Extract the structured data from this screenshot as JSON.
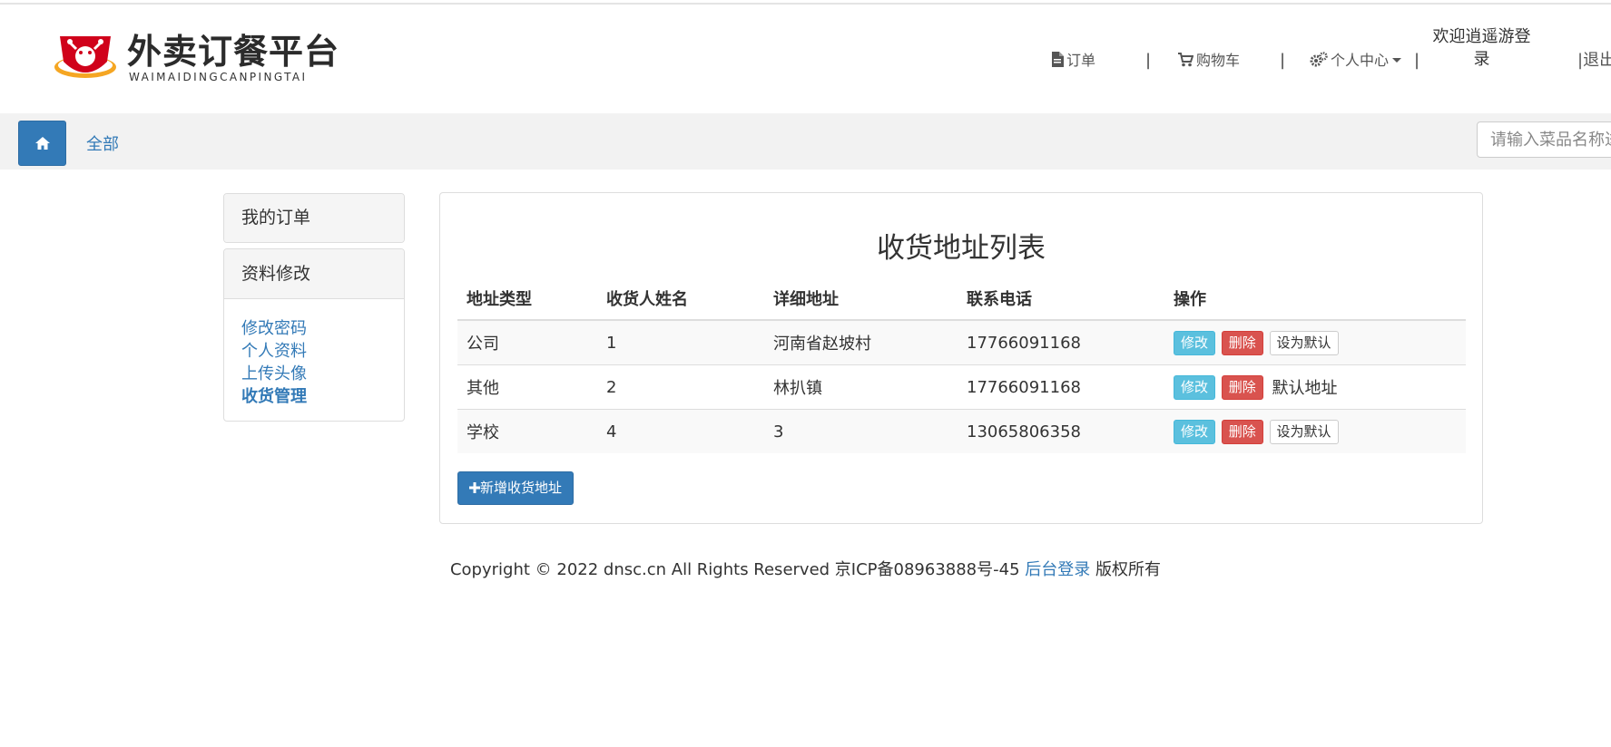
{
  "brand": {
    "name_cn": "外卖订餐平台",
    "name_en": "WAIMAIDINGCANPINGTAI",
    "logo_icon": "crab-logo-icon"
  },
  "nav": {
    "orders": {
      "label": "订单",
      "icon": "file-icon"
    },
    "cart": {
      "label": "购物车",
      "icon": "cart-icon"
    },
    "profile": {
      "label": "个人中心",
      "icon": "gears-icon"
    },
    "separator": "|",
    "welcome": "欢迎逍遥游登录",
    "logout": "|退出"
  },
  "subbar": {
    "home_icon": "home-icon",
    "category": "全部",
    "search_placeholder": "请输入菜品名称进行搜索"
  },
  "sidebar": {
    "orders_title": "我的订单",
    "profile_title": "资料修改",
    "links": [
      "修改密码",
      "个人资料",
      "上传头像",
      "收货管理"
    ]
  },
  "main": {
    "title": "收货地址列表",
    "columns": [
      "地址类型",
      "收货人姓名",
      "详细地址",
      "联系电话",
      "操作"
    ],
    "rows": [
      {
        "type": "公司",
        "name": "1",
        "address": "河南省赵坡村",
        "phone": "17766091168",
        "edit": "修改",
        "delete": "删除",
        "default": "设为默认",
        "is_default": false
      },
      {
        "type": "其他",
        "name": "2",
        "address": "林扒镇",
        "phone": "17766091168",
        "edit": "修改",
        "delete": "删除",
        "default": "默认地址",
        "is_default": true
      },
      {
        "type": "学校",
        "name": "4",
        "address": "3",
        "phone": "13065806358",
        "edit": "修改",
        "delete": "删除",
        "default": "设为默认",
        "is_default": false
      }
    ],
    "add_button": "新增收货地址",
    "add_icon": "plus-icon"
  },
  "footer": {
    "text": "Copyright © 2022 dnsc.cn All Rights Reserved 京ICP备08963888号-45",
    "admin_link": "后台登录",
    "suffix": "版权所有"
  }
}
